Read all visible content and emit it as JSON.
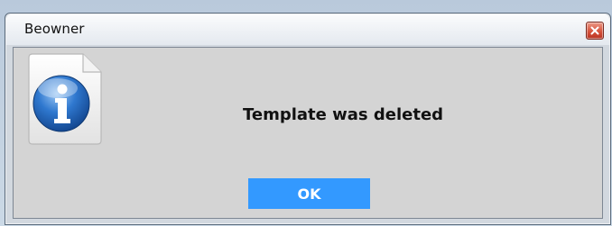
{
  "window": {
    "title": "Beowner",
    "close_icon": "close-icon"
  },
  "dialog": {
    "icon": "info-icon",
    "message": "Template was deleted",
    "ok_label": "OK"
  },
  "colors": {
    "ok_button": "#3399ff",
    "client_bg": "#d4d4d4",
    "close_button": "#d6533c",
    "info_blue": "#1f5fb3"
  }
}
